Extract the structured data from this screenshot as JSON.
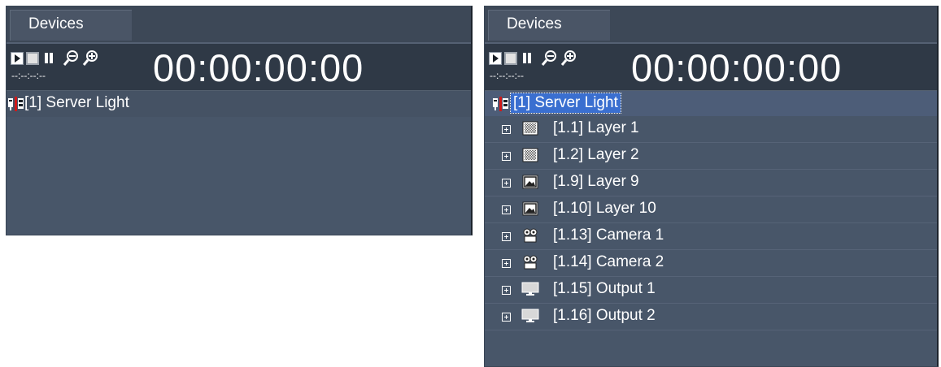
{
  "colors": {
    "panel_bg": "#485669",
    "toolbar_bg": "#2f3946",
    "selection": "#3a6fd0",
    "text": "#ffffff"
  },
  "left_panel": {
    "tab_label": "Devices",
    "timecode": "00:00:00:00",
    "sub_timecode": "--:--:--:--",
    "toolbar_icons": [
      "play-icon",
      "stop-icon",
      "pause-icon",
      "zoom-out-icon",
      "zoom-in-icon"
    ],
    "tree": [
      {
        "label": "[1] Server Light",
        "icon": "server-light-icon"
      }
    ]
  },
  "right_panel": {
    "tab_label": "Devices",
    "timecode": "00:00:00:00",
    "sub_timecode": "--:--:--:--",
    "toolbar_icons": [
      "play-icon",
      "stop-icon",
      "pause-icon",
      "zoom-out-icon",
      "zoom-in-icon"
    ],
    "tree": [
      {
        "label": "[1] Server Light",
        "icon": "server-light-icon",
        "selected": true
      },
      {
        "label": "[1.1] Layer 1",
        "icon": "layer-pattern-icon"
      },
      {
        "label": "[1.2] Layer 2",
        "icon": "layer-pattern-icon"
      },
      {
        "label": "[1.9] Layer 9",
        "icon": "layer-image-icon"
      },
      {
        "label": "[1.10] Layer 10",
        "icon": "layer-image-icon"
      },
      {
        "label": "[1.13] Camera 1",
        "icon": "camera-icon"
      },
      {
        "label": "[1.14] Camera 2",
        "icon": "camera-icon"
      },
      {
        "label": "[1.15] Output 1",
        "icon": "monitor-icon"
      },
      {
        "label": "[1.16] Output 2",
        "icon": "monitor-icon"
      }
    ]
  }
}
